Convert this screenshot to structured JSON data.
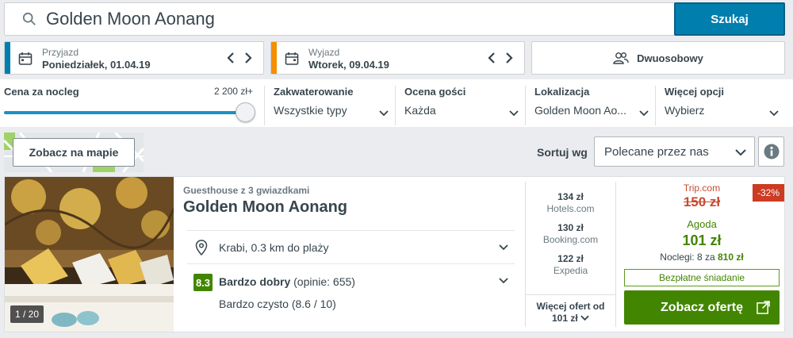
{
  "search": {
    "value": "Golden Moon Aonang",
    "button_label": "Szukaj"
  },
  "dates": {
    "checkin": {
      "label": "Przyjazd",
      "value": "Poniedziałek, 01.04.19",
      "accent": "#007faf"
    },
    "checkout": {
      "label": "Wyjazd",
      "value": "Wtorek, 09.04.19",
      "accent": "#f48f00"
    }
  },
  "room": {
    "label": "Dwuosobowy",
    "icon": "guests-icon"
  },
  "filters": {
    "price": {
      "title": "Cena za nocleg",
      "max": "2 200 zł+",
      "level": 1.0
    },
    "accommodation": {
      "title": "Zakwaterowanie",
      "value": "Wszystkie typy"
    },
    "rating": {
      "title": "Ocena gości",
      "value": "Każda"
    },
    "location": {
      "title": "Lokalizacja",
      "value": "Golden Moon Ao..."
    },
    "more": {
      "title": "Więcej opcji",
      "value": "Wybierz"
    }
  },
  "map": {
    "button_label": "Zobacz na mapie"
  },
  "sort": {
    "label": "Sortuj wg",
    "value": "Polecane przez nas"
  },
  "hotel": {
    "type": "Guesthouse z 3 gwiazdkami",
    "name": "Golden Moon Aonang",
    "photo_counter": "1 / 20",
    "location": "Krabi, 0.3 km do plaży",
    "rating_score": "8.3",
    "rating_word": "Bardzo dobry",
    "rating_count": "(opinie: 655)",
    "cleanliness": "Bardzo czysto (8.6 / 10)",
    "offers": [
      {
        "price": "134 zł",
        "site": "Hotels.com"
      },
      {
        "price": "130 zł",
        "site": "Booking.com"
      },
      {
        "price": "122 zł",
        "site": "Expedia"
      }
    ],
    "more_offers_line1": "Więcej ofert od",
    "more_offers_line2": "101 zł",
    "deal": {
      "old_source": "Trip.com",
      "old_price": "150 zł",
      "discount": "-32%",
      "source": "Agoda",
      "price": "101 zł",
      "nights_text": "Noclegi: 8 za",
      "nights_total": "810 zł",
      "breakfast": "Bezpłatne śniadanie",
      "cta": "Zobacz ofertę"
    }
  },
  "colors": {
    "brand_blue": "#007faf",
    "deal_green": "#428500",
    "discount_red": "#cc3b22"
  }
}
